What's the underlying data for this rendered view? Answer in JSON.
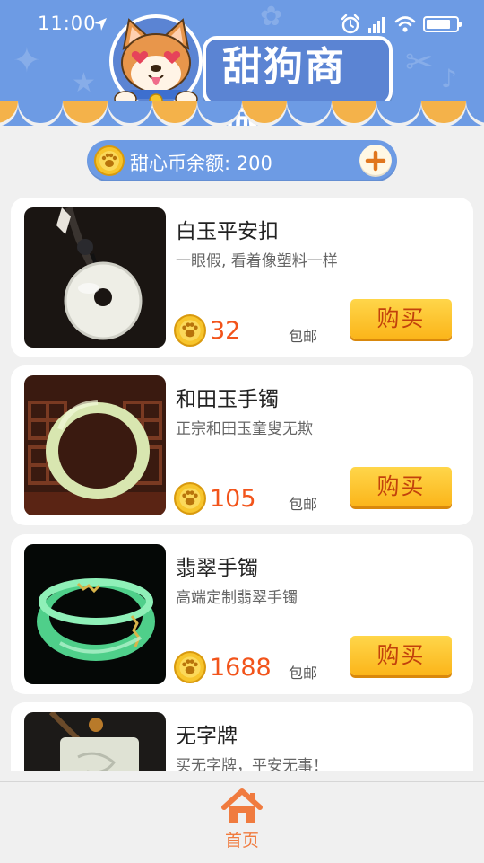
{
  "status_bar": {
    "time": "11:00",
    "battery_level": 0.8
  },
  "header": {
    "title": "甜狗商城",
    "background_color": "#6d9be4",
    "icons": [
      "location-arrow-icon",
      "alarm-icon",
      "signal-icon",
      "wifi-icon",
      "battery-icon",
      "shiba-dog-logo"
    ]
  },
  "balance": {
    "text": "甜心币余额: 200",
    "add_icon": "plus-icon"
  },
  "products": [
    {
      "name": "白玉平安扣",
      "description": "一眼假, 看着像塑料一样",
      "price": "32",
      "shipping": "包邮",
      "buy_label": "购买",
      "image": "white-jade-donut-pendant"
    },
    {
      "name": "和田玉手镯",
      "description": "正宗和田玉童叟无欺",
      "price": "105",
      "shipping": "包邮",
      "buy_label": "购买",
      "image": "hetian-jade-bangle"
    },
    {
      "name": "翡翠手镯",
      "description": "高端定制翡翠手镯",
      "price": "1688",
      "shipping": "包邮",
      "buy_label": "购买",
      "image": "jadeite-bangle-gold-inlay"
    },
    {
      "name": "无字牌",
      "description": "买无字牌，平安无事！",
      "image": "blank-jade-tablet-pendant"
    }
  ],
  "bottom_nav": {
    "home_label": "首页",
    "home_icon": "home-icon",
    "accent_color": "#f07b3f"
  },
  "colors": {
    "price": "#f2541b",
    "buy_button": "#fbb51a",
    "coin": "#f7c52c"
  }
}
